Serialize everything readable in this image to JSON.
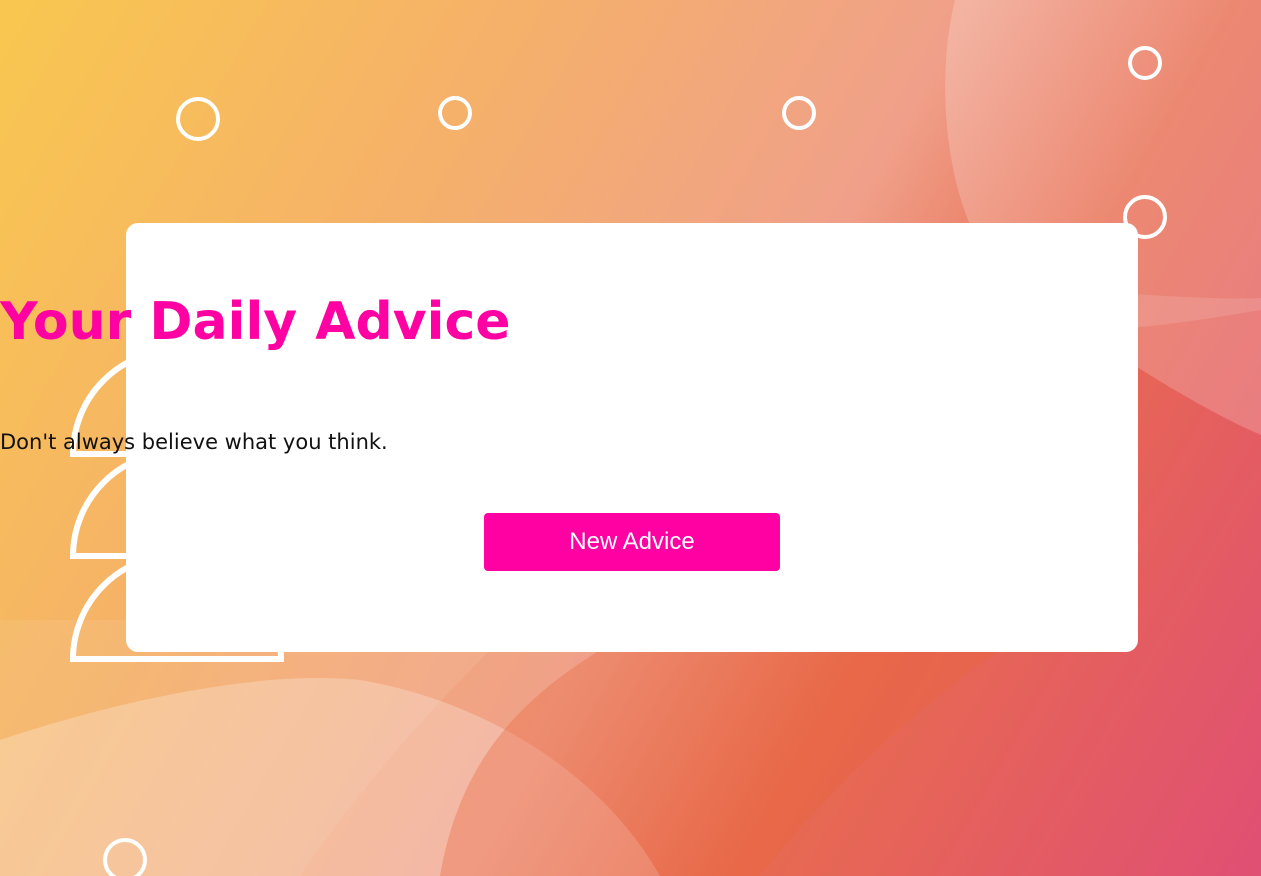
{
  "page": {
    "title": "Your Daily Advice",
    "advice": "Don't always believe what you think.",
    "button_label": "New Advice"
  },
  "colors": {
    "accent": "#ff00a2",
    "card_background": "#ffffff",
    "decor_outline": "#ffffff",
    "gradient_start": "#f9c74f",
    "gradient_end": "#e04f74"
  }
}
